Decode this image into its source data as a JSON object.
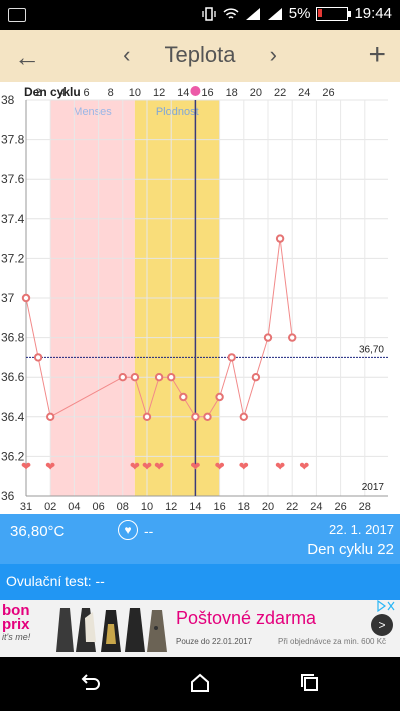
{
  "status": {
    "battery_percent": "5%",
    "time": "19:44"
  },
  "appbar": {
    "title": "Teplota",
    "prev": "‹",
    "next": "›",
    "back": "←",
    "add": "+"
  },
  "chart_data": {
    "type": "line",
    "top_axis_label": "Den cyklu",
    "top_ticks": [
      "2",
      "4",
      "6",
      "8",
      "10",
      "12",
      "14",
      "16",
      "18",
      "20",
      "22",
      "24",
      "26"
    ],
    "bottom_ticks": [
      "31",
      "02",
      "04",
      "06",
      "08",
      "10",
      "12",
      "14",
      "16",
      "18",
      "20",
      "22",
      "24",
      "26",
      "28"
    ],
    "y_ticks": [
      "36",
      "36.2",
      "36.4",
      "36.6",
      "36.8",
      "37",
      "37.2",
      "37.4",
      "37.6",
      "37.8",
      "38"
    ],
    "ylim": [
      36,
      38
    ],
    "days": [
      1,
      2,
      3,
      9,
      10,
      11,
      12,
      13,
      14,
      15,
      16,
      17,
      18,
      19,
      20,
      21,
      22,
      23
    ],
    "values": [
      37.0,
      36.7,
      36.4,
      36.6,
      36.6,
      36.4,
      36.6,
      36.6,
      36.5,
      36.4,
      36.4,
      36.5,
      36.7,
      36.4,
      36.6,
      36.8,
      37.3,
      36.8
    ],
    "hearts": [
      1,
      3,
      10,
      11,
      12,
      15,
      17,
      19,
      22,
      24
    ],
    "bands": [
      {
        "label": "Menses",
        "from": 3,
        "to": 10,
        "color": "#ffd6d6"
      },
      {
        "label": "Plodnost",
        "from": 10,
        "to": 17,
        "color": "#f9dd7a"
      }
    ],
    "coverline": {
      "value": 36.7,
      "label": "36,70"
    },
    "current_day": 15,
    "year_label": "2017",
    "series_color": "#f28a8a"
  },
  "info": {
    "temperature": "36,80°C",
    "heart_icon": "heart-icon",
    "intercourse": "--",
    "date": "22. 1. 2017",
    "cycle_day": "Den cyklu 22"
  },
  "ovulation": {
    "label": "Ovulační test: --"
  },
  "ad": {
    "brand_line1": "bon",
    "brand_line2": "prix",
    "brand_tag": "it's me!",
    "headline": "Poštovné zdarma",
    "sub1": "Pouze do 22.01.2017",
    "sub2": "Při objednávce za min. 600 Kč",
    "go": ">"
  }
}
